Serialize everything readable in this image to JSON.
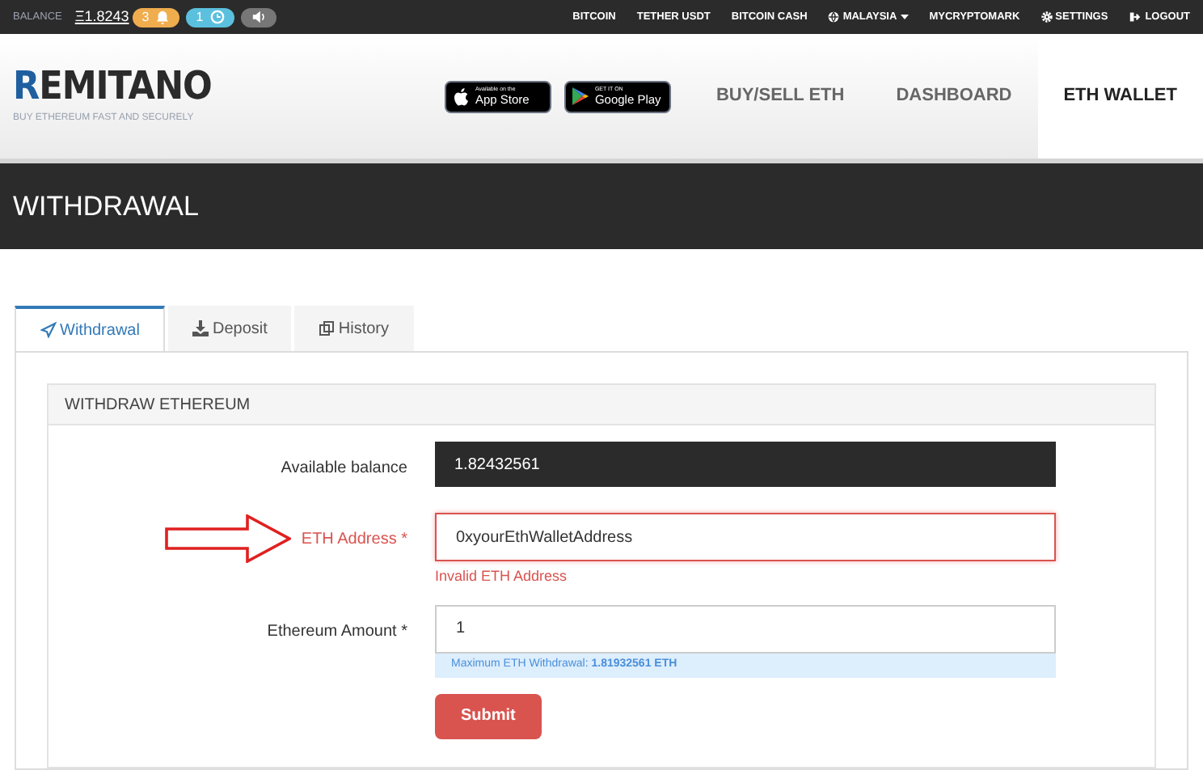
{
  "top_bar": {
    "balance_label": "BALANCE",
    "balance": "Ξ1.8243",
    "badges": [
      {
        "kind": "bell",
        "count": "3",
        "color": "#f0ad4e"
      },
      {
        "kind": "clock",
        "count": "1",
        "color": "#5bc0de"
      },
      {
        "kind": "sound",
        "color": "#777777"
      }
    ],
    "links": [
      {
        "label": "BITCOIN",
        "kind": "plain"
      },
      {
        "label": "TETHER USDT",
        "kind": "plain"
      },
      {
        "label": "BITCOIN CASH",
        "kind": "plain"
      },
      {
        "label": "MALAYSIA",
        "kind": "region"
      },
      {
        "label": "MYCRYPTOMARK",
        "kind": "plain"
      },
      {
        "label": "SETTINGS",
        "kind": "settings"
      },
      {
        "label": "LOGOUT",
        "kind": "logout"
      }
    ]
  },
  "header": {
    "logo_first": "R",
    "logo_rest": "EMITANO",
    "tagline": "BUY ETHEREUM FAST AND SECURELY",
    "stores": [
      {
        "kind": "apple",
        "small": "Available on the",
        "big": "App Store"
      },
      {
        "kind": "google",
        "small": "GET IT ON",
        "big": "Google Play"
      }
    ],
    "nav": [
      {
        "label": "BUY/SELL ETH",
        "selected": false
      },
      {
        "label": "DASHBOARD",
        "selected": false
      },
      {
        "label": "ETH WALLET",
        "selected": true
      }
    ]
  },
  "page_title": "WITHDRAWAL",
  "tabs": [
    {
      "label": "Withdrawal",
      "kind": "withdrawal",
      "selected": true
    },
    {
      "label": "Deposit",
      "kind": "deposit",
      "selected": false
    },
    {
      "label": "History",
      "kind": "history",
      "selected": false
    }
  ],
  "panel": {
    "title": "WITHDRAW ETHEREUM",
    "fields": [
      {
        "kind": "readonly",
        "label": "Available balance",
        "value": "1.82432561"
      },
      {
        "kind": "input",
        "label": "ETH Address *",
        "value": "0xyourEthWalletAddress",
        "error": "Invalid ETH Address",
        "annotated": true
      },
      {
        "kind": "input",
        "label": "Ethereum Amount *",
        "value": "1",
        "help": "Maximum ETH Withdrawal: **1.81932561 ETH**"
      }
    ],
    "submit": "Submit"
  }
}
